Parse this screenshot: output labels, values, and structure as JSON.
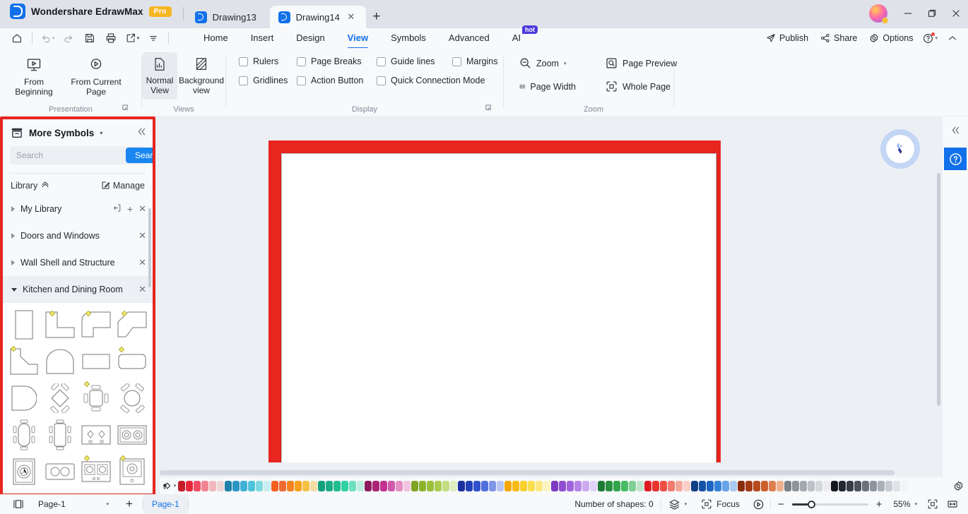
{
  "titlebar": {
    "brand_name": "Wondershare EdrawMax",
    "pro_badge": "Pro",
    "brand_logo_icon": "edrawmax-logo-icon",
    "tabs": [
      {
        "label": "Drawing13",
        "active": false,
        "icon": "document-icon"
      },
      {
        "label": "Drawing14",
        "active": true,
        "icon": "document-icon",
        "close_icon": "close-icon"
      }
    ],
    "new_tab_icon": "plus-icon",
    "avatar_icon": "user-avatar",
    "window_controls": [
      "minimize-icon",
      "restore-icon",
      "close-icon"
    ]
  },
  "menubar": {
    "quick_access": [
      "home-icon",
      "undo-icon",
      "redo-icon",
      "save-icon",
      "print-icon",
      "export-share-icon",
      "customize-icon"
    ],
    "menus": [
      {
        "label": "Home",
        "active": false
      },
      {
        "label": "Insert",
        "active": false
      },
      {
        "label": "Design",
        "active": false
      },
      {
        "label": "View",
        "active": true
      },
      {
        "label": "Symbols",
        "active": false
      },
      {
        "label": "Advanced",
        "active": false
      },
      {
        "label": "AI",
        "active": false,
        "badge": "hot"
      }
    ],
    "right_items": [
      {
        "label": "Publish",
        "icon": "publish-icon"
      },
      {
        "label": "Share",
        "icon": "share-icon"
      },
      {
        "label": "Options",
        "icon": "gear-icon"
      }
    ],
    "help_icon": "help-circle-icon",
    "collapse_ribbon_icon": "chevron-up-icon"
  },
  "ribbon": {
    "groups": [
      {
        "caption": "Presentation",
        "has_launcher": true,
        "buttons": [
          {
            "label": "From\nBeginning",
            "label_line1": "From",
            "label_line2": "Beginning",
            "icon": "present-from-beginning-icon"
          },
          {
            "label": "From Current Page",
            "label_line1": "From Current",
            "label_line2": "Page",
            "icon": "present-from-current-icon"
          }
        ]
      },
      {
        "caption": "Views",
        "has_launcher": false,
        "buttons": [
          {
            "label_line1": "Normal",
            "label_line2": "View",
            "icon": "normal-view-icon",
            "selected": true
          },
          {
            "label_line1": "Background",
            "label_line2": "view",
            "icon": "background-view-icon",
            "selected": false
          }
        ]
      },
      {
        "caption": "Display",
        "has_launcher": true,
        "checkboxes_row1": [
          {
            "label": "Rulers",
            "checked": false
          },
          {
            "label": "Page Breaks",
            "checked": false
          },
          {
            "label": "Guide lines",
            "checked": false
          },
          {
            "label": "Margins",
            "checked": false
          }
        ],
        "checkboxes_row2": [
          {
            "label": "Gridlines",
            "checked": false
          },
          {
            "label": "Action Button",
            "checked": false
          },
          {
            "label": "Quick Connection Mode",
            "checked": false
          }
        ]
      },
      {
        "caption": "Zoom",
        "has_launcher": false,
        "items_row1": [
          {
            "label": "Zoom",
            "icon": "zoom-out-icon",
            "has_caret": true
          },
          {
            "label": "Page Preview",
            "icon": "page-preview-icon"
          }
        ],
        "items_row2": [
          {
            "label": "Page Width",
            "icon": "page-width-icon"
          },
          {
            "label": "Whole Page",
            "icon": "whole-page-icon"
          }
        ]
      }
    ]
  },
  "left_panel": {
    "title": "More Symbols",
    "title_icon": "symbols-library-icon",
    "title_caret_icon": "chevron-down-icon",
    "collapse_icon": "double-chevron-left-icon",
    "search": {
      "placeholder": "Search",
      "value": "",
      "button_label": "Search"
    },
    "library_label": "Library",
    "library_collapse_icon": "double-chevron-up-icon",
    "manage_label": "Manage",
    "manage_icon": "edit-icon",
    "categories": [
      {
        "label": "My Library",
        "expanded": false,
        "actions": [
          "import-icon",
          "plus-icon",
          "close-icon"
        ]
      },
      {
        "label": "Doors and Windows",
        "expanded": false,
        "actions": [
          "close-icon"
        ]
      },
      {
        "label": "Wall Shell and Structure",
        "expanded": false,
        "actions": [
          "close-icon"
        ]
      },
      {
        "label": "Kitchen and Dining Room",
        "expanded": true,
        "actions": [
          "close-icon"
        ]
      }
    ],
    "symbols": [
      {
        "name": "rectangle-counter",
        "selected": false
      },
      {
        "name": "l-shape-counter",
        "selected": true
      },
      {
        "name": "l-shape-rounded-counter",
        "selected": true
      },
      {
        "name": "l-shape-angled-counter",
        "selected": true
      },
      {
        "name": "angled-corner-counter",
        "selected": true
      },
      {
        "name": "arched-counter",
        "selected": false
      },
      {
        "name": "rectangle-table",
        "selected": false
      },
      {
        "name": "rounded-rectangle-table",
        "selected": true
      },
      {
        "name": "quarter-round-counter",
        "selected": false
      },
      {
        "name": "diamond-table-4-chairs",
        "selected": false
      },
      {
        "name": "square-table-4-chairs",
        "selected": true
      },
      {
        "name": "round-table-4-chairs",
        "selected": false
      },
      {
        "name": "oval-table-6-chairs",
        "selected": false
      },
      {
        "name": "rect-table-6-chairs",
        "selected": false
      },
      {
        "name": "two-burner-cooktop",
        "selected": false
      },
      {
        "name": "double-coil-stove",
        "selected": false
      },
      {
        "name": "washing-machine",
        "selected": false
      },
      {
        "name": "double-sink",
        "selected": false
      },
      {
        "name": "gas-cooktop",
        "selected": true
      },
      {
        "name": "single-burner-stove",
        "selected": true
      }
    ]
  },
  "canvas": {
    "assistant_icon": "ai-assistant-icon",
    "highlight_color": "#e8251f"
  },
  "right_rail": {
    "collapse_icon": "double-chevron-left-icon",
    "help_icon": "help-circle-icon",
    "help_bg": "#1271ea"
  },
  "palette": {
    "fill_icon": "fill-color-icon",
    "caret_icon": "chevron-down-icon",
    "gear_icon": "gear-icon",
    "colors": [
      "#c31e28",
      "#e8263a",
      "#ef4b62",
      "#f08391",
      "#f0b8bd",
      "#eed6d6",
      "#1f7fa8",
      "#2b95c4",
      "#3fb0d6",
      "#4fc3d9",
      "#7fd9e0",
      "#c9eef2",
      "#f4601f",
      "#ef6a33",
      "#f58220",
      "#f6a01c",
      "#f7c143",
      "#f6dda6",
      "#12a07a",
      "#1aac87",
      "#20bd8f",
      "#2fd1a0",
      "#6fdfbf",
      "#bdeedf",
      "#8d1b5e",
      "#a92473",
      "#c23290",
      "#d05aaa",
      "#e68fc4",
      "#f1c4de",
      "#7fa322",
      "#8bb22c",
      "#99bf3a",
      "#a9cc4f",
      "#c4de84",
      "#dfeec0",
      "#1b2f9e",
      "#2240b5",
      "#2f52cc",
      "#4f70db",
      "#7f96e8",
      "#b9c6f2",
      "#f5a800",
      "#f7bb12",
      "#f8cf2b",
      "#f9de4d",
      "#fbe97f",
      "#fdf5c0",
      "#7e3ac1",
      "#8f4ecf",
      "#a063dd",
      "#b684e7",
      "#cbaaef",
      "#e2d2f7",
      "#1e7b35",
      "#27903f",
      "#31a54c",
      "#46bb62",
      "#7ed094",
      "#c0e6cb",
      "#e11b22",
      "#e8342e",
      "#ee4f44",
      "#f27a6e",
      "#f6a79c",
      "#facfc8",
      "#0f3f86",
      "#1551a4",
      "#1c66c2",
      "#3481d8",
      "#67a4e6",
      "#a8c9f2",
      "#8a2c0f",
      "#a33a16",
      "#b74a1f",
      "#cb5f2c",
      "#dd7f4f",
      "#eeb08e",
      "#7a8188",
      "#8d949b",
      "#a3a9af",
      "#bcc1c6",
      "#d4d8db",
      "#ececee",
      "#15181c",
      "#222831",
      "#353c45",
      "#4b535d",
      "#6a727c",
      "#8c949e",
      "#aab0b8",
      "#c7ccd2",
      "#dfe2e6",
      "#f1f3f5"
    ]
  },
  "statusbar": {
    "view_mode_icon": "page-view-icon",
    "page_selector_label": "Page-1",
    "page_selector_caret": "chevron-down-icon",
    "add_page_icon": "plus-icon",
    "page_tab_label": "Page-1",
    "shapes_label": "Number of shapes: 0",
    "layers_icon": "layers-icon",
    "focus_label": "Focus",
    "focus_icon": "focus-icon",
    "play_icon": "play-circle-icon",
    "zoom_out_icon": "minus-icon",
    "zoom_in_icon": "plus-icon",
    "zoom_level": "55%",
    "zoom_caret": "chevron-down-icon",
    "fit_page_icon": "fit-page-icon",
    "fit_width_icon": "fit-width-icon"
  }
}
